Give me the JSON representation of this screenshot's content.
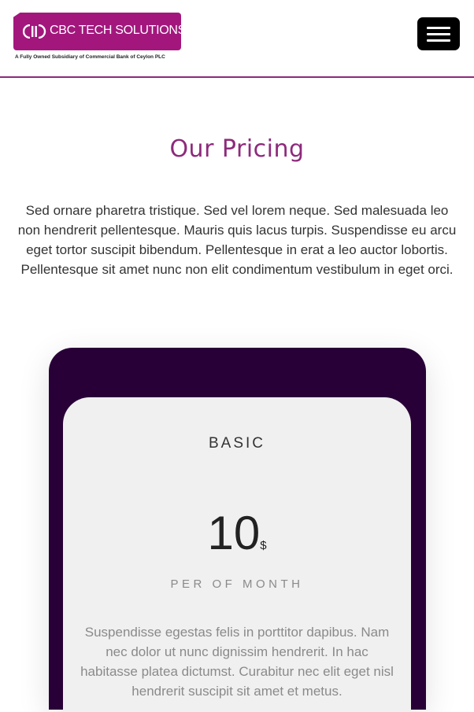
{
  "header": {
    "logo": {
      "name": "CBC TECH SOLUTIONS",
      "tagline": "A Fully Owned Subsidiary of Commercial Bank of Ceylon PLC"
    },
    "menu_icon": "hamburger-icon"
  },
  "colors": {
    "brand": "#a3177d",
    "title": "#8e2a7c",
    "card_dark": "#280037",
    "card_light": "#f0f0f0"
  },
  "pricing": {
    "title": "Our Pricing",
    "intro": "Sed ornare pharetra tristique. Sed vel lorem neque. Sed malesuada leo non hendrerit pellentesque. Mauris quis lacus turpis. Suspendisse eu arcu eget tortor suscipit bibendum. Pellentesque in erat a leo auctor lobortis. Pellentesque sit amet nunc non elit condimentum vestibulum in eget orci.",
    "plans": [
      {
        "name": "BASIC",
        "price": "10",
        "currency": "$",
        "period": "PER OF MONTH",
        "description": "Suspendisse egestas felis in porttitor dapibus. Nam nec dolor ut nunc dignissim hendrerit. In hac habitasse platea dictumst. Curabitur nec elit eget nisl hendrerit suscipit sit amet et metus."
      }
    ]
  }
}
